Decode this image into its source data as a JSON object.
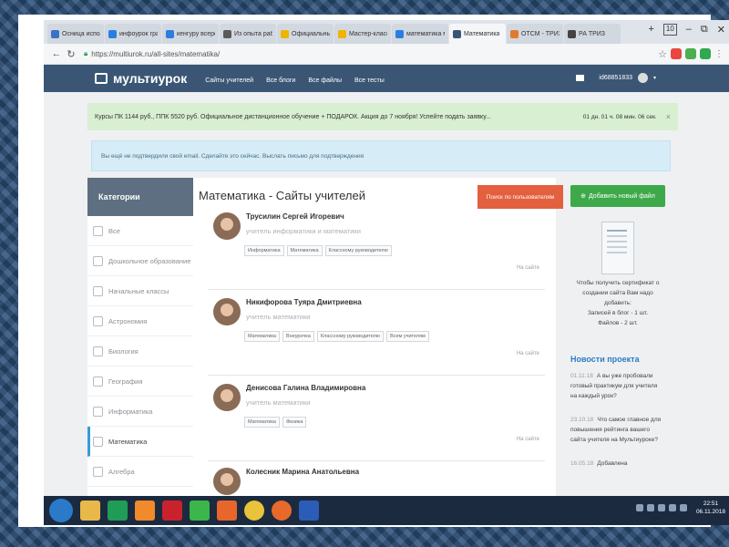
{
  "tabs": [
    {
      "label": "Осница исполь",
      "color": "#3b73c4",
      "active": false
    },
    {
      "label": "инфоурок граф",
      "color": "#2b7de0",
      "active": false
    },
    {
      "label": "кенгуру всерос",
      "color": "#2b7de0",
      "active": false
    },
    {
      "label": "Из опыта работ",
      "color": "#5a5a5a",
      "active": false
    },
    {
      "label": "Официальный с",
      "color": "#f0b400",
      "active": false
    },
    {
      "label": "Мастер-класс",
      "color": "#f0b400",
      "active": false
    },
    {
      "label": "математика ма",
      "color": "#2b7de0",
      "active": false
    },
    {
      "label": "Математика",
      "color": "#3a5674",
      "active": true
    },
    {
      "label": "ОТСМ - ТРИЗ",
      "color": "#e07b2b",
      "active": false
    },
    {
      "label": "РА ТРИЗ",
      "color": "#444444",
      "active": false
    }
  ],
  "window": {
    "new_tab": "+",
    "tab_count": "10",
    "minimize": "–",
    "restore": "⧉",
    "close": "✕"
  },
  "address": {
    "url": "https://multiurok.ru/all-sites/matematika/"
  },
  "site": {
    "logo": "мультиурок",
    "menu": [
      "Сайты учителей",
      "Все блоги",
      "Все файлы",
      "Все тесты"
    ],
    "user_id": "id68851833"
  },
  "promo": {
    "text": "Курсы ПК 1144 руб., ППК 5520 руб. Официальное дистанционное обучение + ПОДАРОК. Акция до 7 ноября! Успейте подать заявку...",
    "timer": "01 дн. 01 ч. 08 мин. 06 сек.",
    "close": "×"
  },
  "notice": {
    "text": "Вы ещё не подтвердили свой email. Сделайте это сейчас. Выслать письмо для подтверждения"
  },
  "sidebar": {
    "title": "Категории",
    "items": [
      "Все",
      "Дошкольное образование",
      "Начальные классы",
      "Астрономия",
      "Биология",
      "География",
      "Информатика",
      "Математика",
      "Алгебра"
    ]
  },
  "main": {
    "title": "Математика - Сайты учителей",
    "search_button": "Поиск по пользователям",
    "on_site": "На сайте",
    "teachers": [
      {
        "name": "Трусилин Сергей Игоревич",
        "subject": "учитель информатики и математики",
        "tags": [
          "Информатика",
          "Математика",
          "Классному руководителю"
        ]
      },
      {
        "name": "Никифорова Туяра Дмитриевна",
        "subject": "учитель математики",
        "tags": [
          "Математика",
          "Внеурочка",
          "Классному руководителю",
          "Всем учителям"
        ]
      },
      {
        "name": "Денисова Галина Владимировна",
        "subject": "учитель математики",
        "tags": [
          "Математика",
          "Физика"
        ]
      },
      {
        "name": "Колесник Марина Анатольевна",
        "subject": "",
        "tags": []
      }
    ]
  },
  "right": {
    "add_button": "Добавить новый файл",
    "cert_lines": [
      "Чтобы получить сертификат о",
      "создании сайта Вам надо",
      "добавить:",
      "Записей в блог - 1 шт.",
      "Файлов - 2 шт."
    ],
    "news_title": "Новости проекта",
    "news": [
      {
        "date": "01.11.18",
        "lines": [
          "А вы уже пробовали",
          "готовый практикум для учителя",
          "на каждый урок?"
        ]
      },
      {
        "date": "23.10.18",
        "lines": [
          "Что самое главное для",
          "повышения рейтинга вашего",
          "сайта учителя на Мультиуроке?"
        ]
      },
      {
        "date": "16.05.18",
        "lines": [
          "Добавлена"
        ]
      }
    ]
  },
  "taskbar": {
    "time": "22:51",
    "date": "06.11.2018"
  }
}
